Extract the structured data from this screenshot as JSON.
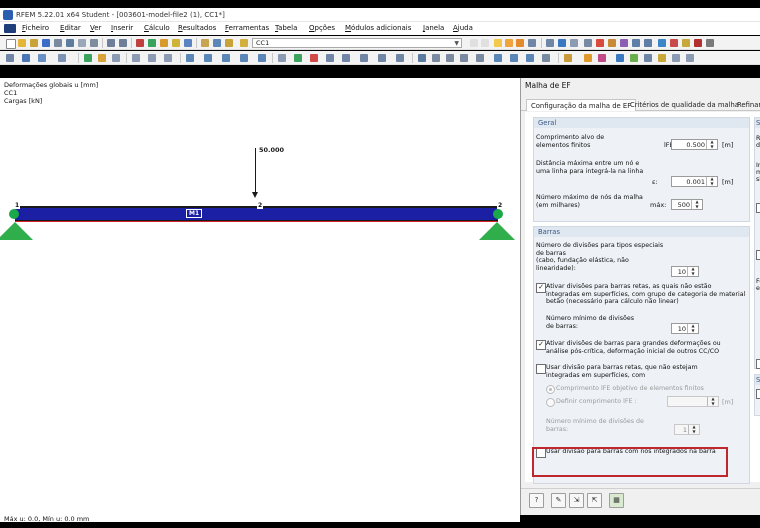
{
  "window": {
    "title": "RFEM 5.22.01 x64 Student - [003601-model-file2 (1), CC1*]"
  },
  "menu": [
    "Ficheiro",
    "Editar",
    "Ver",
    "Inserir",
    "Cálculo",
    "Resultados",
    "Ferramentas",
    "Tabela",
    "Opções",
    "Módulos adicionais",
    "Janela",
    "Ajuda"
  ],
  "toolbar": {
    "load_case": "CC1"
  },
  "canvas": {
    "info_lines": [
      "Deformações globais u [mm]",
      "CC1",
      "Cargas [kN]"
    ],
    "load_value": "50.000",
    "member_label": "M1",
    "node_labels": [
      "1",
      "2",
      "2"
    ],
    "status": "Máx u: 0.0, Mín u: 0.0 mm"
  },
  "dialog": {
    "title": "Malha de EF",
    "tabs": [
      "Configuração da malha de EF",
      "Critérios de qualidade da malha",
      "Refinar"
    ],
    "general": {
      "header": "Geral",
      "target_length_label": [
        "Comprimento alvo de",
        "elementos finitos"
      ],
      "target_length_symbol": "lFE:",
      "target_length_value": "0.500",
      "target_length_unit": "[m]",
      "max_distance_label": [
        "Distância máxima entre um nó e",
        "uma linha para integrá-la na linha"
      ],
      "max_distance_symbol": "ε:",
      "max_distance_value": "0.001",
      "max_distance_unit": "[m]",
      "max_nodes_label": [
        "Número máximo de nós da malha",
        "(em milhares)"
      ],
      "max_nodes_symbol": "máx:",
      "max_nodes_value": "500"
    },
    "bars": {
      "header": "Barras",
      "divisions_label": [
        "Número de divisões para tipos especiais",
        "de barras",
        "(cabo, fundação elástica, não",
        "linearidade):"
      ],
      "divisions_value": "10",
      "activate_straight_label": [
        "Ativar divisões para barras retas, as quais não estão",
        "integradas em superfícies, com grupo de categoria de material",
        "betão (necessário para cálculo não linear)"
      ],
      "activate_straight_checked": true,
      "min_divisions_label": [
        "Número mínimo de divisões",
        "de barras:"
      ],
      "min_divisions_value": "10",
      "large_def_label": [
        "Ativar divisões de barras para grandes deformações ou",
        "análise pós-crítica, deformação inicial de outros CC/CO"
      ],
      "large_def_checked": true,
      "use_division_label": [
        "Usar divisão para barras retas, que não estejam",
        "integradas em superfícies, com"
      ],
      "use_division_checked": false,
      "radio_target_label": "Comprimento lFE objetivo de elementos finitos",
      "radio_define_label": "Definir comprimento lFE :",
      "radio_define_unit": "[m]",
      "min_div_dis_label": [
        "Número mínimo de divisões de",
        "barras:"
      ],
      "min_div_dis_value": "1",
      "nodes_division_label": "Usar divisão para barras com nós integrados na barra",
      "nodes_division_checked": false
    },
    "right_col": {
      "header": "Su",
      "lines": [
        "Re",
        "di",
        "In",
        "ma",
        "sii",
        "Fo",
        "ele",
        "Só"
      ]
    }
  }
}
